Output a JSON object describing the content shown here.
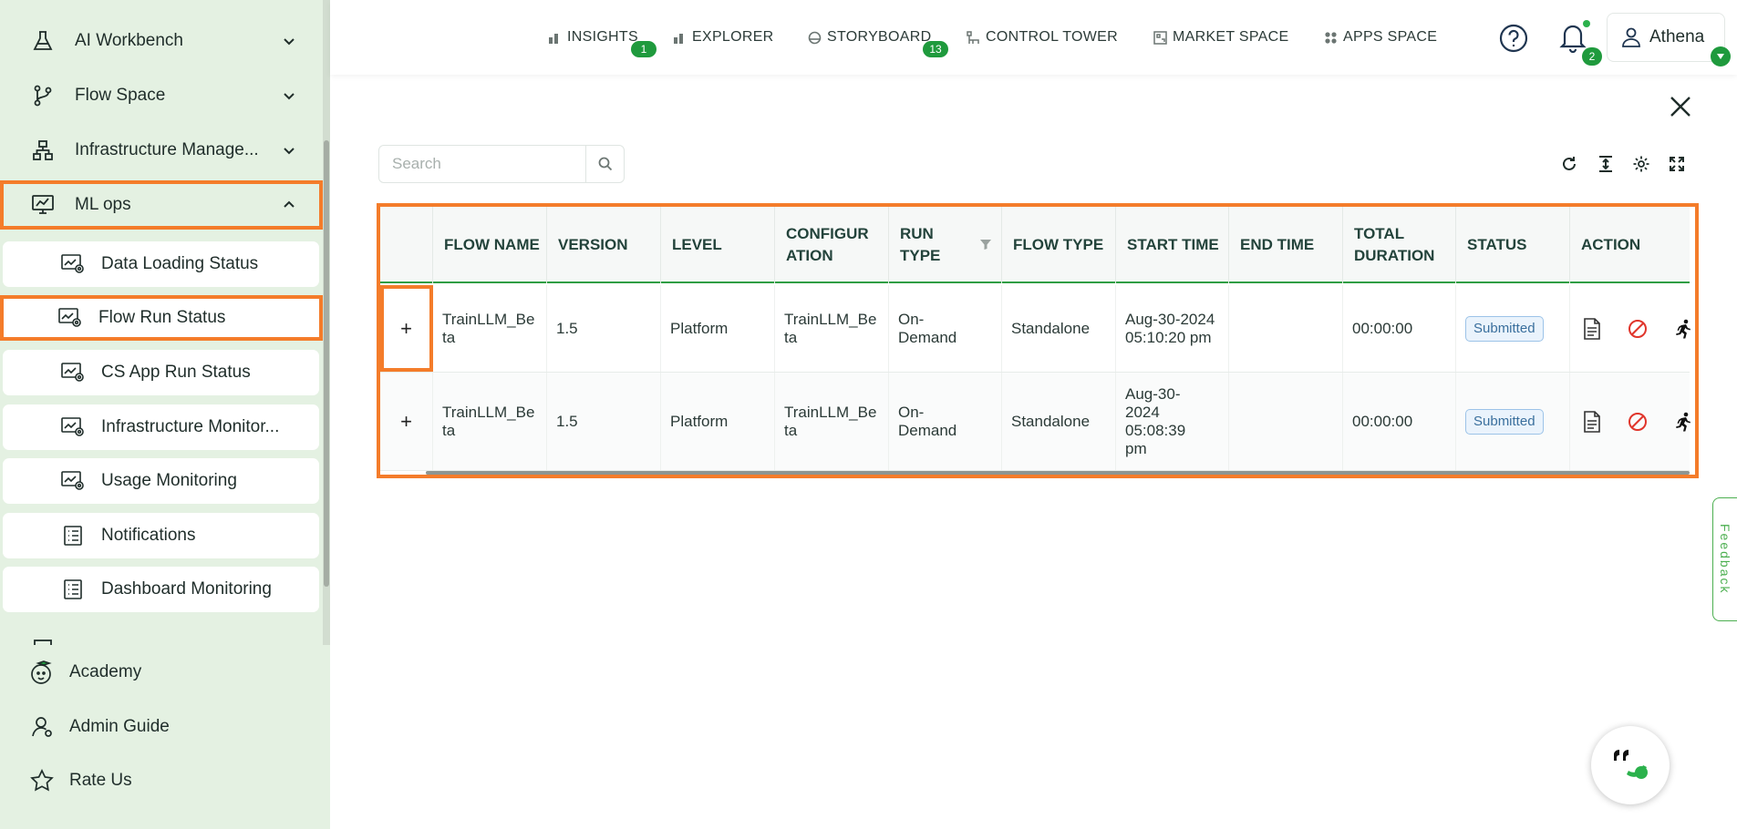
{
  "sidebar": {
    "groups": [
      {
        "label": "AI Workbench",
        "icon": "flask-icon",
        "expanded": false
      },
      {
        "label": "Flow Space",
        "icon": "branch-icon",
        "expanded": false
      },
      {
        "label": "Infrastructure Manage...",
        "icon": "hierarchy-icon",
        "expanded": false
      },
      {
        "label": "ML ops",
        "icon": "chart-monitor-icon",
        "expanded": true
      }
    ],
    "subitems": [
      {
        "label": "Data Loading Status",
        "icon": "monitor-gear-icon"
      },
      {
        "label": "Flow Run Status",
        "icon": "monitor-gear-icon",
        "active": true
      },
      {
        "label": "CS App Run Status",
        "icon": "monitor-gear-icon"
      },
      {
        "label": "Infrastructure Monitor...",
        "icon": "monitor-gear-icon"
      },
      {
        "label": "Usage Monitoring",
        "icon": "monitor-gear-icon"
      },
      {
        "label": "Notifications",
        "icon": "list-icon"
      },
      {
        "label": "Dashboard Monitoring",
        "icon": "list-icon"
      }
    ],
    "bottom": [
      {
        "label": "Academy",
        "icon": "academy-icon"
      },
      {
        "label": "Admin Guide",
        "icon": "admin-user-icon"
      },
      {
        "label": "Rate Us",
        "icon": "star-icon"
      }
    ]
  },
  "topnav": {
    "items": [
      {
        "label": "INSIGHTS",
        "icon": "bar-chart-icon",
        "badge": "1"
      },
      {
        "label": "EXPLORER",
        "icon": "bar-chart-icon"
      },
      {
        "label": "STORYBOARD",
        "icon": "storyboard-icon",
        "badge": "13"
      },
      {
        "label": "CONTROL TOWER",
        "icon": "tower-icon"
      },
      {
        "label": "MARKET SPACE",
        "icon": "market-icon"
      },
      {
        "label": "APPS SPACE",
        "icon": "apps-icon"
      }
    ],
    "notifications_count": "2",
    "user_name": "Athena"
  },
  "search": {
    "placeholder": "Search",
    "value": ""
  },
  "table": {
    "columns": [
      "FLOW NAME",
      "VERSION",
      "LEVEL",
      "CONFIGUR ATION",
      "RUN TYPE",
      "FLOW TYPE",
      "START TIME",
      "END TIME",
      "TOTAL DURATION",
      "STATUS",
      "ACTION"
    ],
    "rows": [
      {
        "expand": "+",
        "flow_name": "TrainLLM_Beta",
        "version": "1.5",
        "level": "Platform",
        "configuration": "TrainLLM_Beta",
        "run_type": "On-Demand",
        "flow_type": "Standalone",
        "start_time": "Aug-30-2024 05:10:20 pm",
        "end_time": "",
        "total_duration": "00:00:00",
        "status": "Submitted"
      },
      {
        "expand": "+",
        "flow_name": "TrainLLM_Beta",
        "version": "1.5",
        "level": "Platform",
        "configuration": "TrainLLM_Beta",
        "run_type": "On-Demand",
        "flow_type": "Standalone",
        "start_time": "Aug-30-2024 05:08:39 pm",
        "end_time": "",
        "total_duration": "00:00:00",
        "status": "Submitted"
      }
    ]
  },
  "feedback_label": "Feedback",
  "colors": {
    "accent": "#1f9a3d",
    "highlight": "#f47c2a",
    "sidebar_bg": "#e4f1e2",
    "status": "#3a6f9d"
  }
}
